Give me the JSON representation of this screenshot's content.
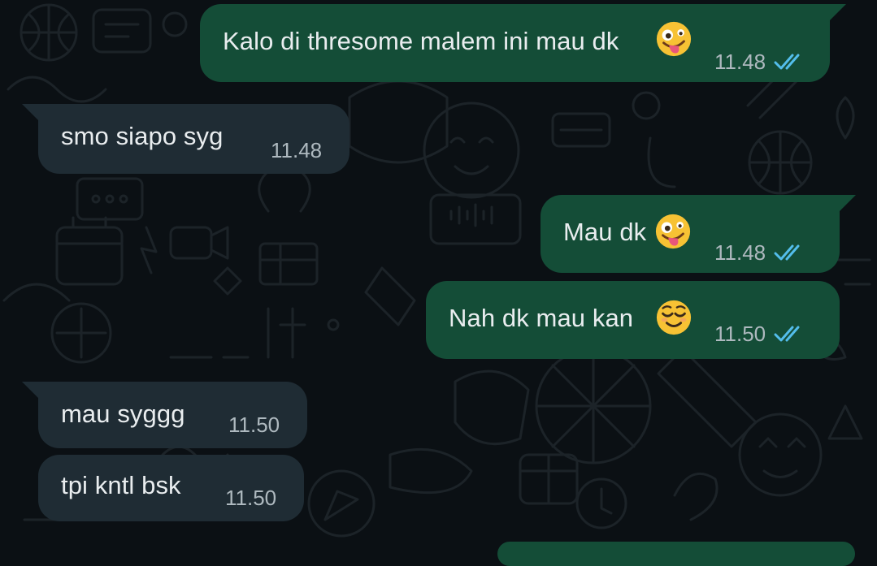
{
  "app": {
    "name": "WhatsApp",
    "theme": "dark",
    "colors": {
      "background": "#0b1014",
      "incoming_bubble": "#1f2c34",
      "outgoing_bubble": "#144d37",
      "text": "#e9edef",
      "meta_text": "#aeb9bf",
      "read_ticks": "#53bdeb",
      "wallpaper_doodles": "#1c2328"
    }
  },
  "messages": [
    {
      "id": "m1",
      "direction": "outgoing",
      "text": "Kalo di thresome malem ini mau dk",
      "emoji": "zany-face",
      "time": "11.48",
      "status": "read"
    },
    {
      "id": "m2",
      "direction": "incoming",
      "text": "smo siapo syg",
      "time": "11.48"
    },
    {
      "id": "m3",
      "direction": "outgoing",
      "text": "Mau dk",
      "emoji": "zany-face",
      "time": "11.48",
      "status": "read"
    },
    {
      "id": "m4",
      "direction": "outgoing",
      "text": "Nah dk mau kan ",
      "emoji": "relieved-face",
      "time": "11.50",
      "status": "read"
    },
    {
      "id": "m5",
      "direction": "incoming",
      "text": "mau syggg",
      "time": "11.50"
    },
    {
      "id": "m6",
      "direction": "incoming",
      "text": "tpi kntl bsk",
      "time": "11.50"
    }
  ]
}
